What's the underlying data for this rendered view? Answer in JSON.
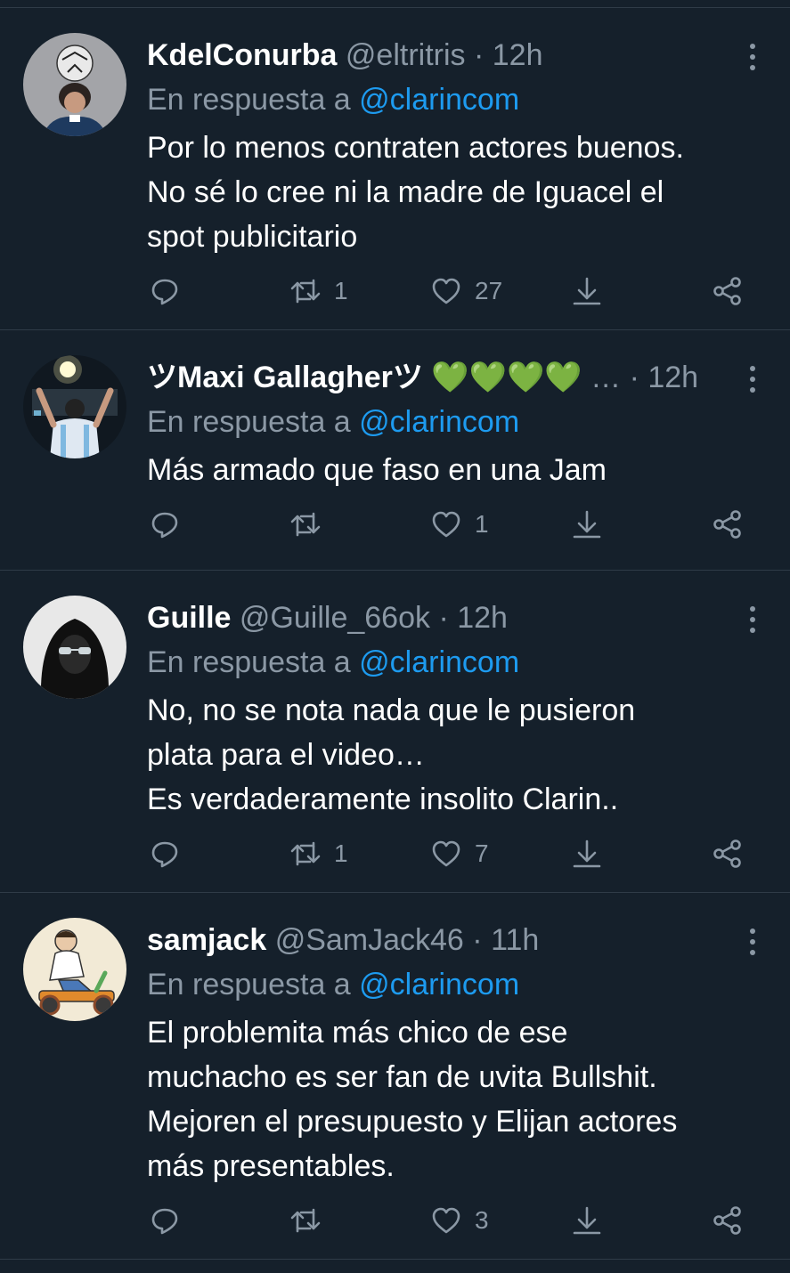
{
  "tweets": [
    {
      "name": "KdelConurba",
      "handle": "@eltritris",
      "separator": "·",
      "time": "12h",
      "reply_prefix": "En respuesta a",
      "reply_mention": "@clarincom",
      "text_lines": [
        "Por lo menos contraten actores buenos.",
        "No sé lo cree ni la madre de Iguacel el",
        "spot publicitario"
      ],
      "counts": {
        "replies": "",
        "retweets": "1",
        "likes": "27"
      }
    },
    {
      "name": "ツMaxi Gallagherツ",
      "name_emoji": "💚💚💚💚",
      "ellipsis": "…",
      "separator": "·",
      "time": "12h",
      "reply_prefix": "En respuesta a",
      "reply_mention": "@clarincom",
      "text_lines": [
        "Más armado que faso en una Jam"
      ],
      "counts": {
        "replies": "",
        "retweets": "",
        "likes": "1"
      }
    },
    {
      "name": "Guille",
      "handle": "@Guille_66ok",
      "separator": "·",
      "time": "12h",
      "reply_prefix": "En respuesta a",
      "reply_mention": "@clarincom",
      "text_lines": [
        "No, no se nota nada que le pusieron",
        "plata para el video…",
        "Es verdaderamente insolito Clarin.."
      ],
      "counts": {
        "replies": "",
        "retweets": "1",
        "likes": "7"
      }
    },
    {
      "name": "samjack",
      "handle": "@SamJack46",
      "separator": "·",
      "time": "11h",
      "reply_prefix": "En respuesta a",
      "reply_mention": "@clarincom",
      "text_lines": [
        "El problemita más chico de ese",
        "muchacho es ser fan de uvita Bullshit.",
        "Mejoren el presupuesto y Elijan actores",
        "más presentables."
      ],
      "counts": {
        "replies": "",
        "retweets": "",
        "likes": "3"
      }
    }
  ],
  "colors": {
    "background": "#15202b",
    "secondary_text": "#8b98a5",
    "mention": "#1d9bf0",
    "divider": "#2f3b47"
  }
}
